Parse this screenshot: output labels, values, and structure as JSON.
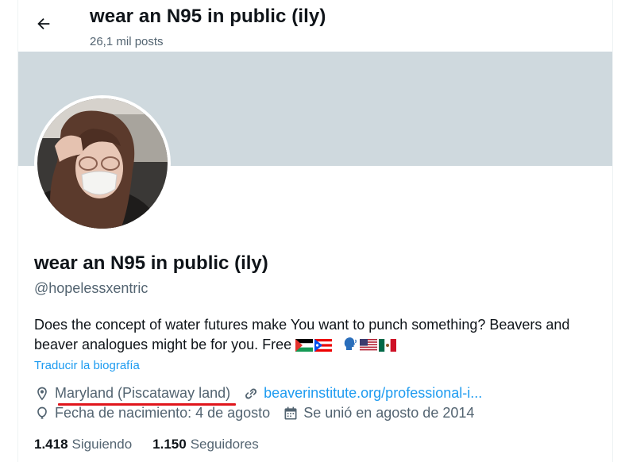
{
  "header": {
    "title": "wear an N95 in public (ily)",
    "post_count": "26,1 mil posts"
  },
  "profile": {
    "display_name": "wear an N95 in public (ily)",
    "handle": "@hopelessxentric",
    "bio_text": "Does the concept of water futures make You want to punch something? Beavers and beaver analogues might be for you. Free",
    "bio_emojis": [
      "Palestine flag",
      "Puerto Rico flag",
      "speaking head",
      "United States flag",
      "Mexico flag"
    ],
    "translate_label": "Traducir la biografía",
    "location": "Maryland (Piscataway land)",
    "website": "beaverinstitute.org/professional-i...",
    "birthdate": "Fecha de nacimiento: 4 de agosto",
    "joined": "Se unió en agosto de 2014",
    "following_count": "1.418",
    "following_label": "Siguiendo",
    "followers_count": "1.150",
    "followers_label": "Seguidores"
  },
  "colors": {
    "banner": "#cfd9de",
    "link": "#1d9bf0",
    "secondary_text": "#536471",
    "annotation_underline": "#e0151b"
  },
  "icons": {
    "back": "arrow-left-icon",
    "location": "map-pin-icon",
    "website": "link-icon",
    "birthdate": "balloon-icon",
    "joined": "calendar-icon"
  }
}
